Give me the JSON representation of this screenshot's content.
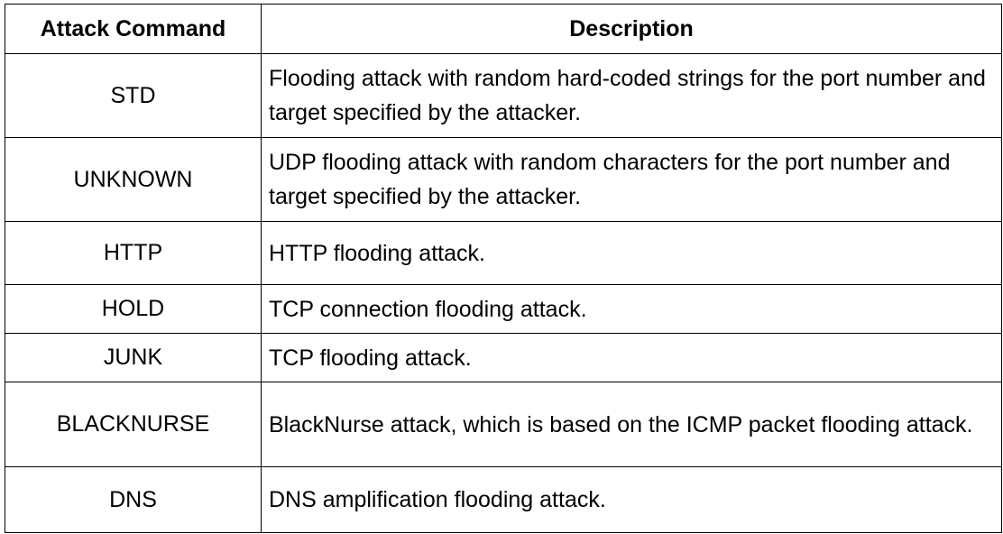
{
  "table": {
    "headers": [
      "Attack Command",
      "Description"
    ],
    "rows": [
      {
        "command": "STD",
        "description": "Flooding attack with random hard-coded strings for the port number and target specified by the attacker."
      },
      {
        "command": "UNKNOWN",
        "description": "UDP flooding attack with random characters for the port number and target specified by the attacker."
      },
      {
        "command": "HTTP",
        "description": "HTTP flooding attack."
      },
      {
        "command": "HOLD",
        "description": "TCP connection flooding attack."
      },
      {
        "command": "JUNK",
        "description": "TCP flooding attack."
      },
      {
        "command": "BLACKNURSE",
        "description": "BlackNurse attack, which is based on the ICMP packet flooding attack."
      },
      {
        "command": "DNS",
        "description": "DNS amplification flooding attack."
      }
    ]
  }
}
